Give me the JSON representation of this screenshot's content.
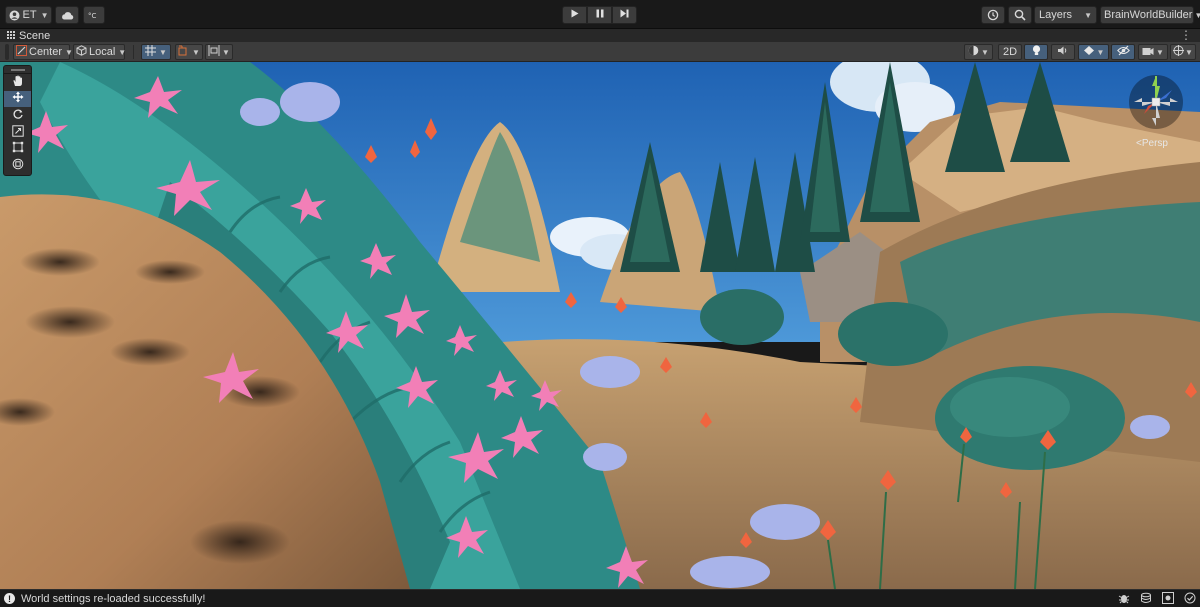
{
  "toolbar": {
    "account_label": "ET",
    "layers_label": "Layers",
    "layout_label": "BrainWorldBuilder",
    "icons": [
      "account-icon",
      "cloud-icon",
      "collab-icon",
      "play-icon",
      "pause-icon",
      "step-icon",
      "history-icon",
      "search-icon"
    ]
  },
  "scene_tab": {
    "label": "Scene"
  },
  "scene_toolbar": {
    "pivot_mode": "Center",
    "pivot_rotation": "Local",
    "view_2d_label": "2D"
  },
  "viewport": {
    "camera_label": "<Persp",
    "sky_color": "#2f78c4"
  },
  "tools": [
    "hand-tool",
    "move-tool",
    "rotate-tool",
    "scale-tool",
    "rect-tool",
    "transform-tool"
  ],
  "status": {
    "message": "World settings re-loaded successfully!"
  }
}
